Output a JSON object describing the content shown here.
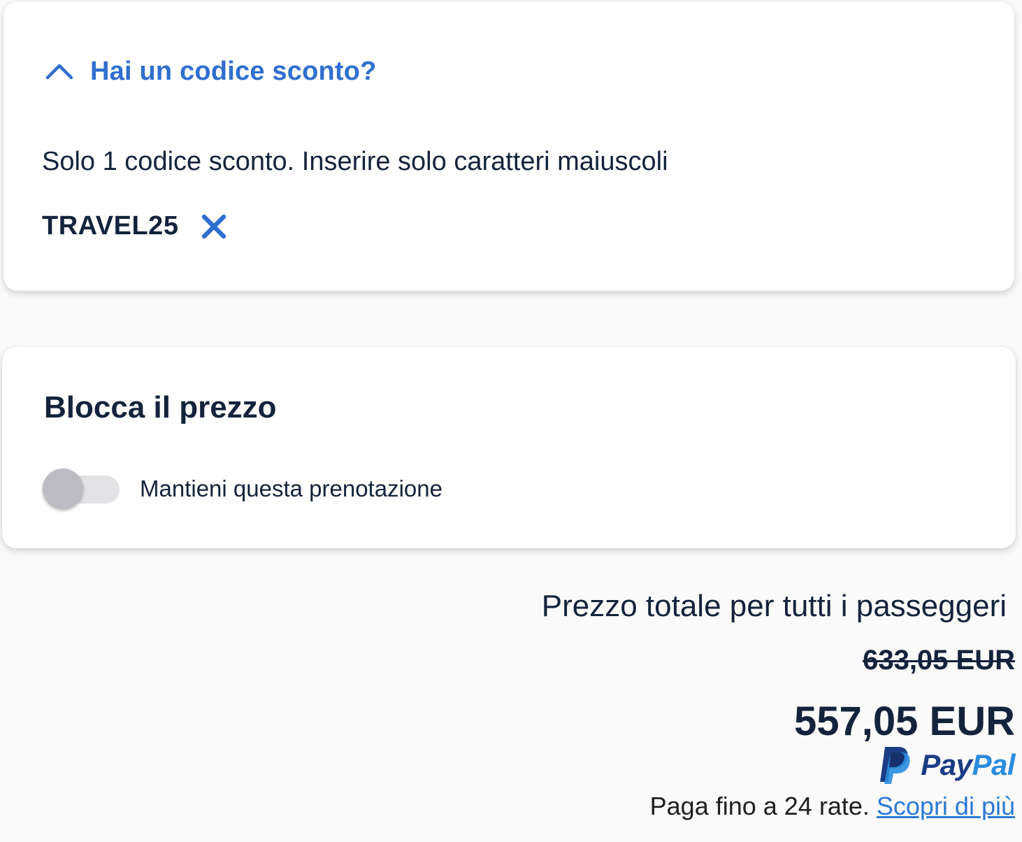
{
  "discount": {
    "toggle_label": "Hai un codice sconto?",
    "expanded": true,
    "hint": "Solo 1 codice sconto. Inserire solo caratteri maiuscoli",
    "applied_code": "TRAVEL25",
    "icons": {
      "toggle": "chevron-up-icon",
      "remove": "close-icon"
    }
  },
  "price_lock": {
    "title": "Blocca il prezzo",
    "toggle_label": "Mantieni questa prenotazione",
    "toggle_on": false
  },
  "summary": {
    "total_label": "Prezzo totale per tutti i passeggeri",
    "original_price": "633,05 EUR",
    "final_price": "557,05 EUR",
    "paypal_pay": "Pay",
    "paypal_pal": "Pal",
    "installments_text": "Paga fino a 24 rate.",
    "installments_link": "Scopri di più"
  },
  "colors": {
    "accent": "#2f6fcf",
    "text_primary": "#14233c",
    "paypal_dark": "#1a3c85",
    "paypal_light": "#2a8cde",
    "link": "#2c79d4",
    "background": "#fafafa"
  }
}
